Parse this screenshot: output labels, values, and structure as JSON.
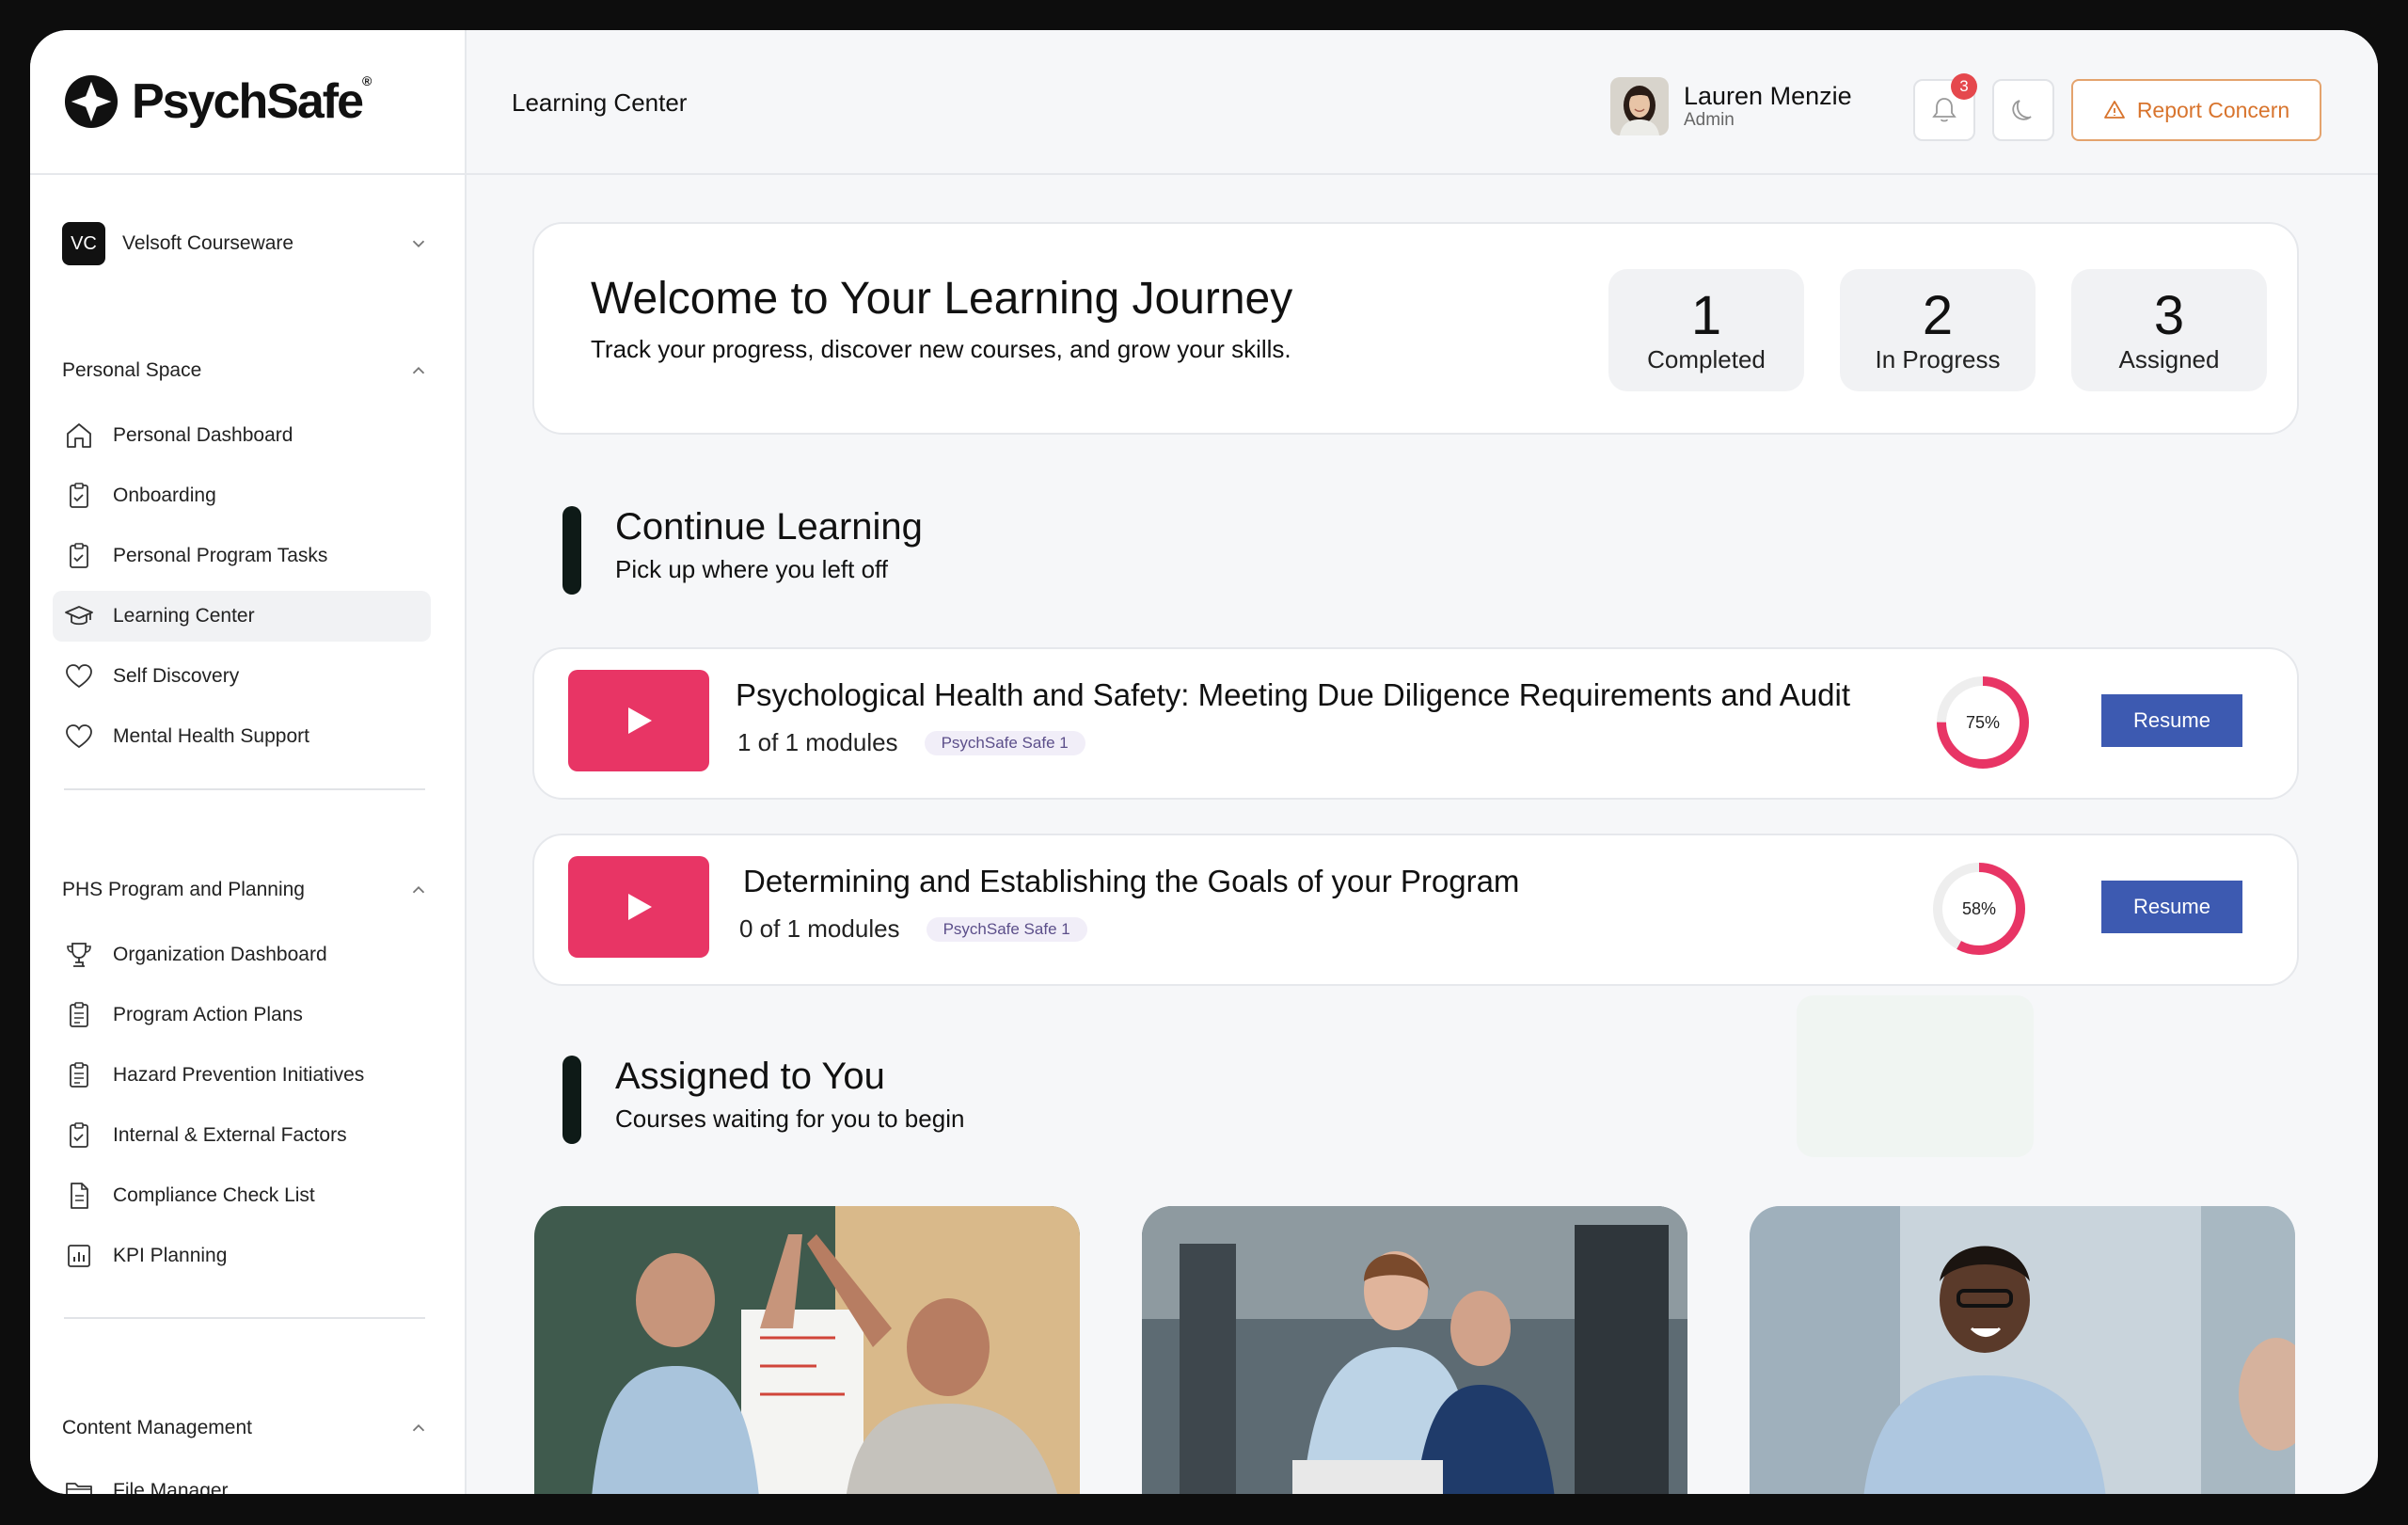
{
  "brand": {
    "name": "PsychSafe",
    "mark": "®"
  },
  "workspace": {
    "initials": "VC",
    "name": "Velsoft Courseware"
  },
  "sidebar": {
    "sections": [
      {
        "title": "Personal Space",
        "items": [
          {
            "label": "Personal Dashboard",
            "icon": "home-icon"
          },
          {
            "label": "Onboarding",
            "icon": "clipboard-check-icon"
          },
          {
            "label": "Personal Program Tasks",
            "icon": "clipboard-check-icon"
          },
          {
            "label": "Learning Center",
            "icon": "graduation-cap-icon",
            "active": true
          },
          {
            "label": "Self Discovery",
            "icon": "heart-icon"
          },
          {
            "label": "Mental Health Support",
            "icon": "heart-icon"
          }
        ]
      },
      {
        "title": "PHS Program and Planning",
        "items": [
          {
            "label": "Organization Dashboard",
            "icon": "trophy-icon"
          },
          {
            "label": "Program Action Plans",
            "icon": "clipboard-list-icon"
          },
          {
            "label": "Hazard Prevention Initiatives",
            "icon": "clipboard-list-icon"
          },
          {
            "label": "Internal & External Factors",
            "icon": "clipboard-check-icon"
          },
          {
            "label": "Compliance Check List",
            "icon": "document-icon"
          },
          {
            "label": "KPI Planning",
            "icon": "bar-chart-icon"
          }
        ]
      },
      {
        "title": "Content Management",
        "items": [
          {
            "label": "File Manager",
            "icon": "folder-icon"
          }
        ]
      }
    ]
  },
  "header": {
    "page_title": "Learning Center",
    "user": {
      "name": "Lauren Menzie",
      "role": "Admin"
    },
    "notifications_count": "3",
    "report_label": "Report Concern"
  },
  "welcome": {
    "title": "Welcome to Your Learning Journey",
    "subtitle": "Track your progress, discover new courses, and grow your skills.",
    "stats": [
      {
        "value": "1",
        "label": "Completed"
      },
      {
        "value": "2",
        "label": "In Progress"
      },
      {
        "value": "3",
        "label": "Assigned"
      }
    ]
  },
  "continue": {
    "title": "Continue Learning",
    "subtitle": "Pick up where you left off",
    "courses": [
      {
        "title": "Psychological Health and Safety: Meeting Due Diligence Requirements and Audit",
        "modules": "1 of 1 modules",
        "tag": "PsychSafe Safe 1",
        "progress_label": "75%",
        "progress": 0.75,
        "action": "Resume"
      },
      {
        "title": "Determining and Establishing the Goals of your Program",
        "modules": "0 of 1 modules",
        "tag": "PsychSafe Safe 1",
        "progress_label": "58%",
        "progress": 0.58,
        "action": "Resume"
      }
    ]
  },
  "assigned": {
    "title": "Assigned to You",
    "subtitle": "Courses waiting for you to begin"
  },
  "colors": {
    "accent": "#e83565",
    "primary": "#3d5ab1",
    "warning": "#d8742d",
    "ring_track": "#eeeeee"
  }
}
